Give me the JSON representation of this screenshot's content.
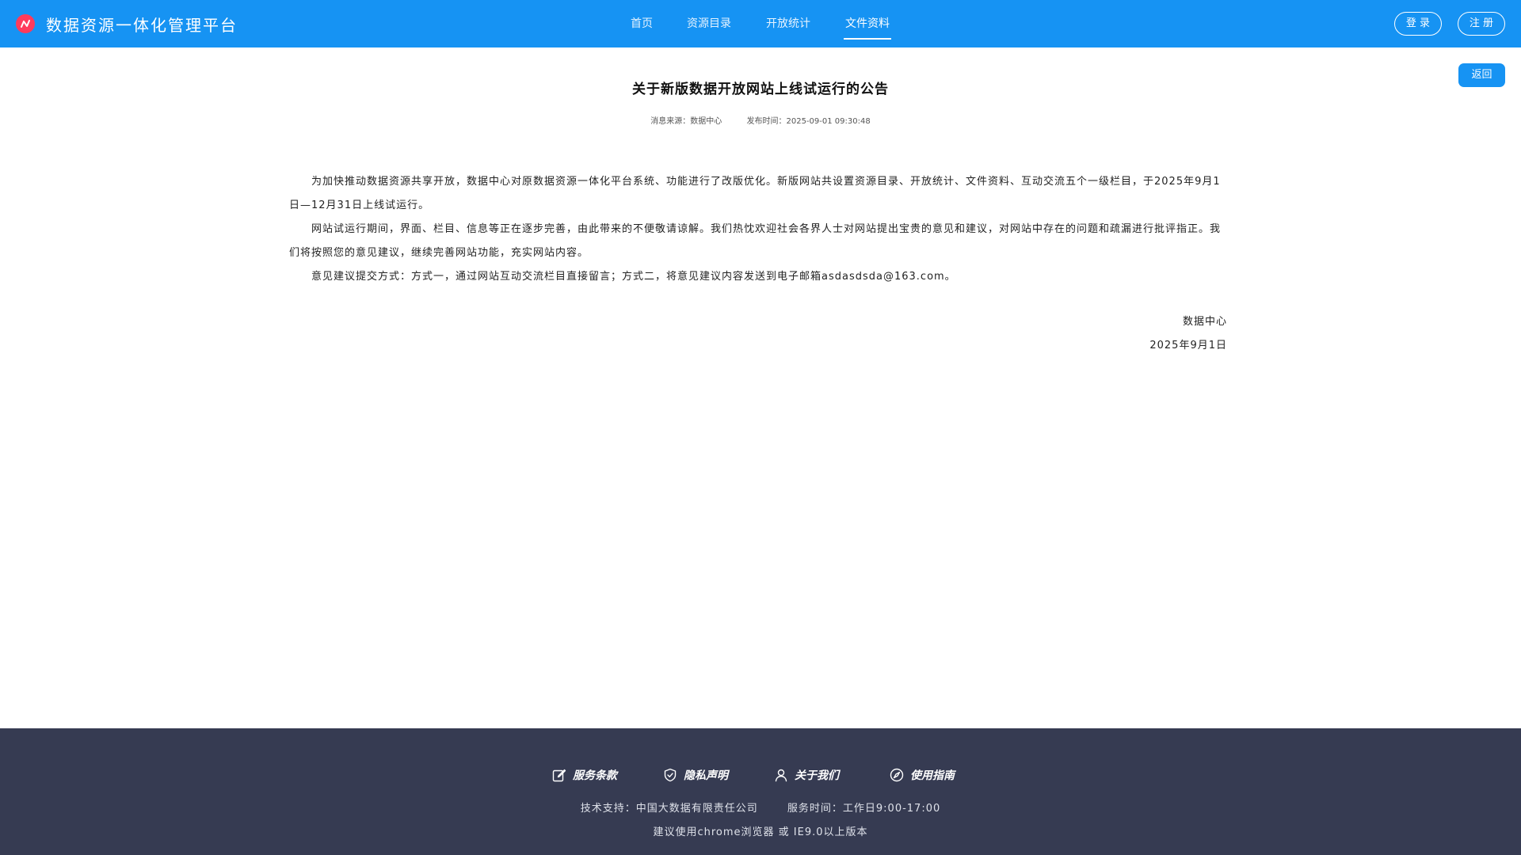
{
  "header": {
    "title": "数据资源一体化管理平台",
    "nav": [
      {
        "label": "首页",
        "active": false
      },
      {
        "label": "资源目录",
        "active": false
      },
      {
        "label": "开放统计",
        "active": false
      },
      {
        "label": "文件资料",
        "active": true
      }
    ],
    "login_label": "登 录",
    "register_label": "注 册"
  },
  "main": {
    "back_label": "返回",
    "title": "关于新版数据开放网站上线试运行的公告",
    "source": "消息来源：数据中心",
    "publish_time": "发布时间：2025-09-01 09:30:48",
    "paragraphs": [
      "为加快推动数据资源共享开放，数据中心对原数据资源一体化平台系统、功能进行了改版优化。新版网站共设置资源目录、开放统计、文件资料、互动交流五个一级栏目，于2025年9月1日—12月31日上线试运行。",
      "网站试运行期间，界面、栏目、信息等正在逐步完善，由此带来的不便敬请谅解。我们热忱欢迎社会各界人士对网站提出宝贵的意见和建议，对网站中存在的问题和疏漏进行批评指正。我们将按照您的意见建议，继续完善网站功能，充实网站内容。",
      "意见建议提交方式：方式一，通过网站互动交流栏目直接留言；方式二，将意见建议内容发送到电子邮箱asdasdsda@163.com。"
    ],
    "signature_org": "数据中心",
    "signature_date": "2025年9月1日"
  },
  "footer": {
    "links": [
      {
        "label": "服务条款",
        "icon": "edit-icon"
      },
      {
        "label": "隐私声明",
        "icon": "shield-check-icon"
      },
      {
        "label": "关于我们",
        "icon": "user-icon"
      },
      {
        "label": "使用指南",
        "icon": "compass-icon"
      }
    ],
    "tech_support": "技术支持：中国大数据有限责任公司",
    "service_time": "服务时间：工作日9:00-17:00",
    "browser_note": "建议使用chrome浏览器 或 IE9.0以上版本"
  },
  "colors": {
    "header_bg": "#1693f3",
    "logo": "#ff3b5c",
    "footer_bg": "#363b52"
  }
}
